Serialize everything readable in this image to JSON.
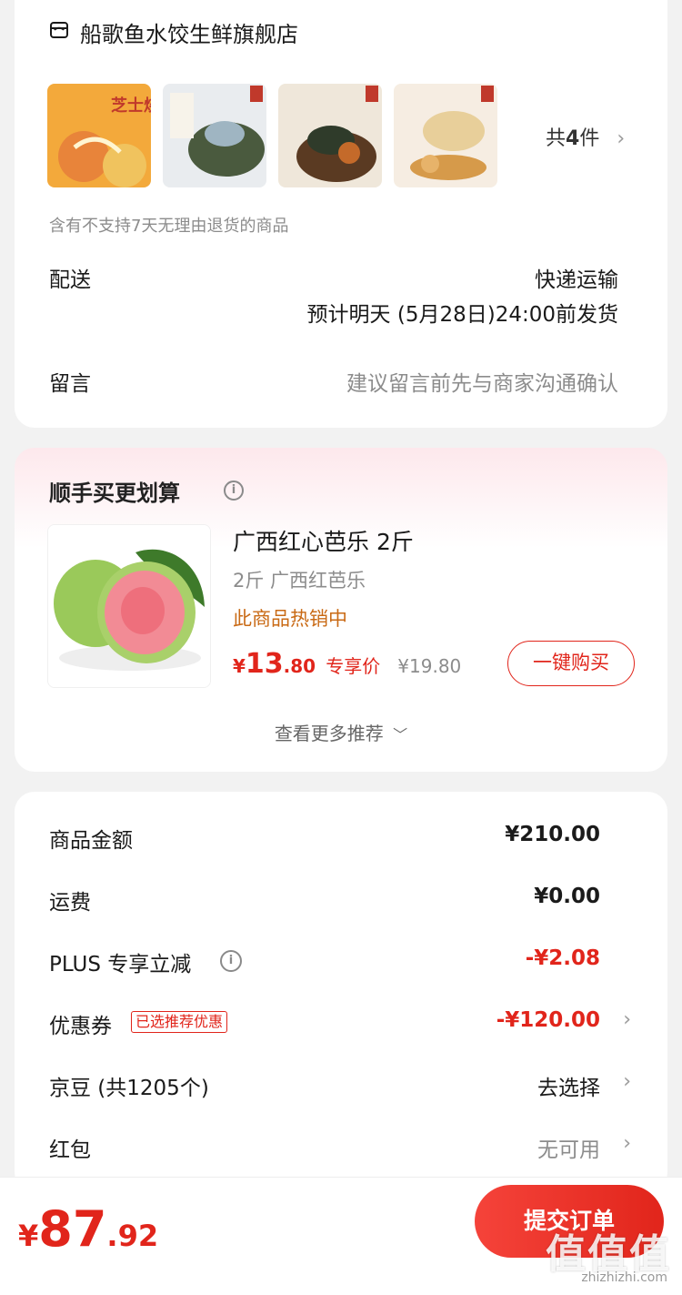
{
  "store": {
    "name": "船歌鱼水饺生鲜旗舰店",
    "thumb1_text": "芝士烧麦",
    "item_count_prefix": "共",
    "item_count": "4",
    "item_count_suffix": "件",
    "return_note": "含有不支持7天无理由退货的商品",
    "delivery_label": "配送",
    "delivery_method": "快递运输",
    "delivery_eta": "预计明天 (5月28日)24:00前发货",
    "message_label": "留言",
    "message_placeholder": "建议留言前先与商家沟通确认"
  },
  "recommend": {
    "title": "顺手买更划算",
    "product_name": "广西红心芭乐 2斤",
    "product_spec": "2斤 广西红芭乐",
    "product_hot": "此商品热销中",
    "price_symbol": "¥",
    "price_int": "13",
    "price_dec": ".80",
    "price_tag": "专享价",
    "original_price": "¥19.80",
    "buy_label": "一键购买",
    "more_label": "查看更多推荐"
  },
  "summary": {
    "goods_amount_label": "商品金额",
    "goods_amount": "¥210.00",
    "shipping_label": "运费",
    "shipping": "¥0.00",
    "plus_label": "PLUS 专享立减",
    "plus_discount": "-¥2.08",
    "coupon_label": "优惠券",
    "coupon_tag": "已选推荐优惠",
    "coupon_value": "-¥120.00",
    "beans_label": "京豆 (共1205个)",
    "beans_value": "去选择",
    "redpacket_label": "红包",
    "redpacket_value": "无可用"
  },
  "footer": {
    "currency": "¥",
    "total_int": "87",
    "total_dec": ".92",
    "submit_label": "提交订单",
    "watermark": "值值值",
    "watermark_sub": "zhizhizhi.com"
  },
  "colors": {
    "accent": "#e1251b",
    "hot": "#c96a15",
    "background": "#f2f2f2"
  }
}
